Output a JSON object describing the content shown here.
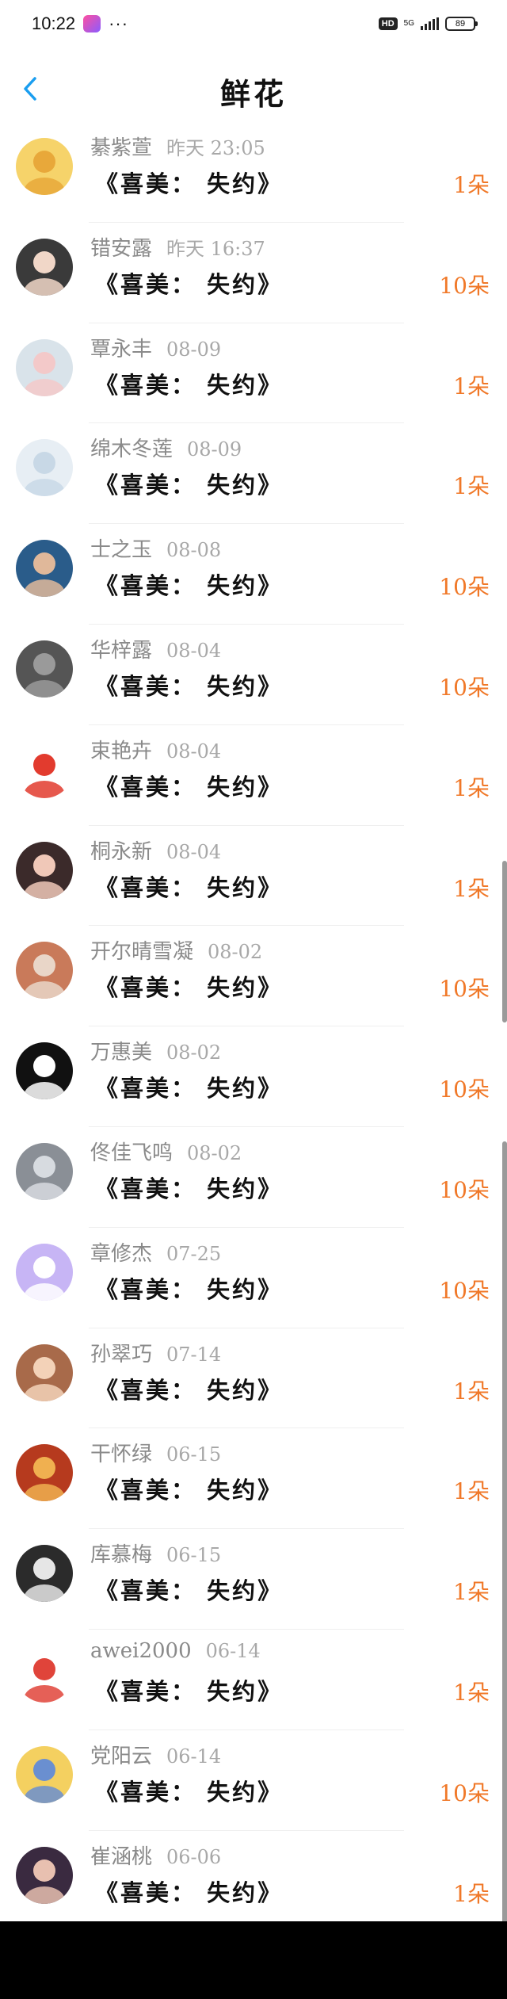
{
  "status_bar": {
    "time": "10:22",
    "dots": "···",
    "hd_badge": "HD",
    "network": "5G",
    "battery": "89"
  },
  "header": {
    "title": "鲜花",
    "back_icon": "chevron-left-icon"
  },
  "colors": {
    "accent_back": "#1a9ef0",
    "count_orange": "#f07828",
    "name_gray": "#8a8a8a"
  },
  "gift_records": [
    {
      "name": "綦紫萱",
      "date": "昨天 23:05",
      "gift": "《喜美： 失约》",
      "count": "1朵"
    },
    {
      "name": "错安露",
      "date": "昨天 16:37",
      "gift": "《喜美： 失约》",
      "count": "10朵"
    },
    {
      "name": "覃永丰",
      "date": "08-09",
      "gift": "《喜美： 失约》",
      "count": "1朵"
    },
    {
      "name": "绵木冬莲",
      "date": "08-09",
      "gift": "《喜美： 失约》",
      "count": "1朵"
    },
    {
      "name": "士之玉",
      "date": "08-08",
      "gift": "《喜美： 失约》",
      "count": "10朵"
    },
    {
      "name": "华梓露",
      "date": "08-04",
      "gift": "《喜美： 失约》",
      "count": "10朵"
    },
    {
      "name": "束艳卉",
      "date": "08-04",
      "gift": "《喜美： 失约》",
      "count": "1朵"
    },
    {
      "name": "桐永新",
      "date": "08-04",
      "gift": "《喜美： 失约》",
      "count": "1朵"
    },
    {
      "name": "开尔晴雪凝",
      "date": "08-02",
      "gift": "《喜美： 失约》",
      "count": "10朵"
    },
    {
      "name": "万惠美",
      "date": "08-02",
      "gift": "《喜美： 失约》",
      "count": "10朵"
    },
    {
      "name": "佟佳飞鸣",
      "date": "08-02",
      "gift": "《喜美： 失约》",
      "count": "10朵"
    },
    {
      "name": "章修杰",
      "date": "07-25",
      "gift": "《喜美： 失约》",
      "count": "10朵"
    },
    {
      "name": "孙翠巧",
      "date": "07-14",
      "gift": "《喜美： 失约》",
      "count": "1朵"
    },
    {
      "name": "干怀绿",
      "date": "06-15",
      "gift": "《喜美： 失约》",
      "count": "1朵"
    },
    {
      "name": "库慕梅",
      "date": "06-15",
      "gift": "《喜美： 失约》",
      "count": "1朵"
    },
    {
      "name": "awei2000",
      "date": "06-14",
      "gift": "《喜美： 失约》",
      "count": "1朵"
    },
    {
      "name": "党阳云",
      "date": "06-14",
      "gift": "《喜美： 失约》",
      "count": "10朵"
    },
    {
      "name": "崔涵桃",
      "date": "06-06",
      "gift": "《喜美： 失约》",
      "count": "1朵"
    }
  ]
}
